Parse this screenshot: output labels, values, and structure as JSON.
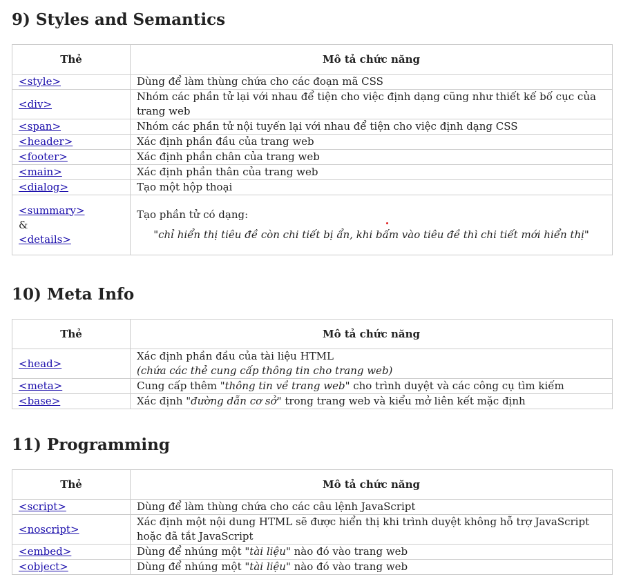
{
  "sections": [
    {
      "title": "9) Styles and Semantics",
      "col_tag": "Thẻ",
      "col_desc": "Mô tả chức năng",
      "rows": [
        {
          "tag": "<style>",
          "desc": "Dùng để làm thùng chứa cho các đoạn mã CSS"
        },
        {
          "tag": "<div>",
          "desc": "Nhóm các phần tử lại với nhau để tiện cho việc định dạng cũng như thiết kế bố cục của trang web"
        },
        {
          "tag": "<span>",
          "desc": "Nhóm các phần tử nội tuyến lại với nhau để tiện cho việc định dạng CSS"
        },
        {
          "tag": "<header>",
          "desc": "Xác định phần đầu của trang web"
        },
        {
          "tag": "<footer>",
          "desc": "Xác định phần chân của trang web"
        },
        {
          "tag": "<main>",
          "desc": "Xác định phần thân của trang web"
        },
        {
          "tag": "<dialog>",
          "desc": "Tạo một hộp thoại"
        },
        {
          "tag": "<summary>",
          "tag_amp": "&",
          "tag2": "<details>",
          "desc": "Tạo phần tử có dạng:",
          "quote": "\"chỉ hiển thị tiêu đề còn chi tiết bị ẩn, khi bấm vào tiêu đề thì chi tiết mới hiển thị\""
        }
      ]
    },
    {
      "title": "10) Meta Info",
      "col_tag": "Thẻ",
      "col_desc": "Mô tả chức năng",
      "rows": [
        {
          "tag": "<head>",
          "desc": "Xác định phần đầu của tài liệu HTML",
          "note": "(chứa các thẻ cung cấp thông tin cho trang web)"
        },
        {
          "tag": "<meta>",
          "desc_pre": "Cung cấp thêm ",
          "desc_em": "\"thông tin về trang web\"",
          "desc_post": " cho trình duyệt và các công cụ tìm kiếm"
        },
        {
          "tag": "<base>",
          "desc_pre": "Xác định ",
          "desc_em": "\"đường dẫn cơ sở\"",
          "desc_post": " trong trang web và kiểu mở liên kết mặc định"
        }
      ]
    },
    {
      "title": "11) Programming",
      "col_tag": "Thẻ",
      "col_desc": "Mô tả chức năng",
      "rows": [
        {
          "tag": "<script>",
          "desc": "Dùng để làm thùng chứa cho các câu lệnh JavaScript"
        },
        {
          "tag": "<noscript>",
          "desc": "Xác định một nội dung HTML sẽ được hiển thị khi trình duyệt không hỗ trợ JavaScript hoặc đã tắt JavaScript"
        },
        {
          "tag": "<embed>",
          "desc_pre": "Dùng để nhúng một ",
          "desc_em": "\"tài liệu\"",
          "desc_post": " nào đó vào trang web"
        },
        {
          "tag": "<object>",
          "desc_pre": "Dùng để nhúng một ",
          "desc_em": "\"tài liệu\"",
          "desc_post": " nào đó vào trang web"
        }
      ]
    }
  ]
}
